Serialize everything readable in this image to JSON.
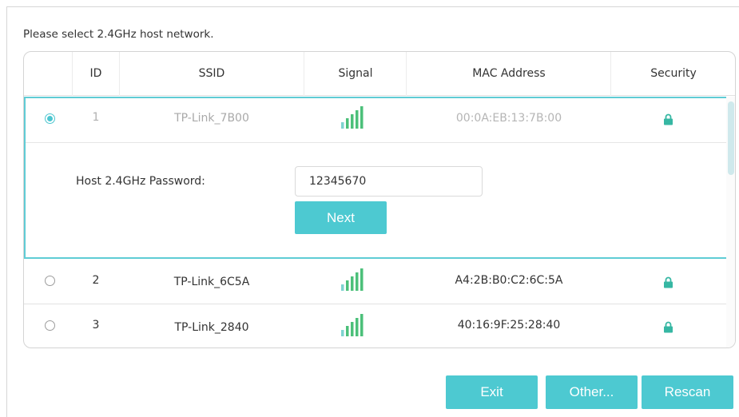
{
  "prompt": "Please select 2.4GHz host network.",
  "headers": {
    "id": "ID",
    "ssid": "SSID",
    "signal": "Signal",
    "mac": "MAC Address",
    "security": "Security"
  },
  "networks": [
    {
      "id": "1",
      "ssid": "TP-Link_7B00",
      "mac": "00:0A:EB:13:7B:00",
      "selected": true,
      "signal_icon": "signal-bars-icon",
      "security_icon": "lock-icon"
    },
    {
      "id": "2",
      "ssid": "TP-Link_6C5A",
      "mac": "A4:2B:B0:C2:6C:5A",
      "selected": false,
      "signal_icon": "signal-bars-icon",
      "security_icon": "lock-icon"
    },
    {
      "id": "3",
      "ssid": "TP-Link_2840",
      "mac": "40:16:9F:25:28:40",
      "selected": false,
      "signal_icon": "signal-bars-icon",
      "security_icon": "lock-icon"
    }
  ],
  "password_panel": {
    "label": "Host 2.4GHz Password:",
    "value": "12345670",
    "next_label": "Next"
  },
  "footer": {
    "exit_label": "Exit",
    "other_label": "Other...",
    "rescan_label": "Rescan"
  },
  "colors": {
    "accent": "#4dc9d1",
    "selected_border": "#5fccd5",
    "muted_text": "#a9a9a9"
  }
}
